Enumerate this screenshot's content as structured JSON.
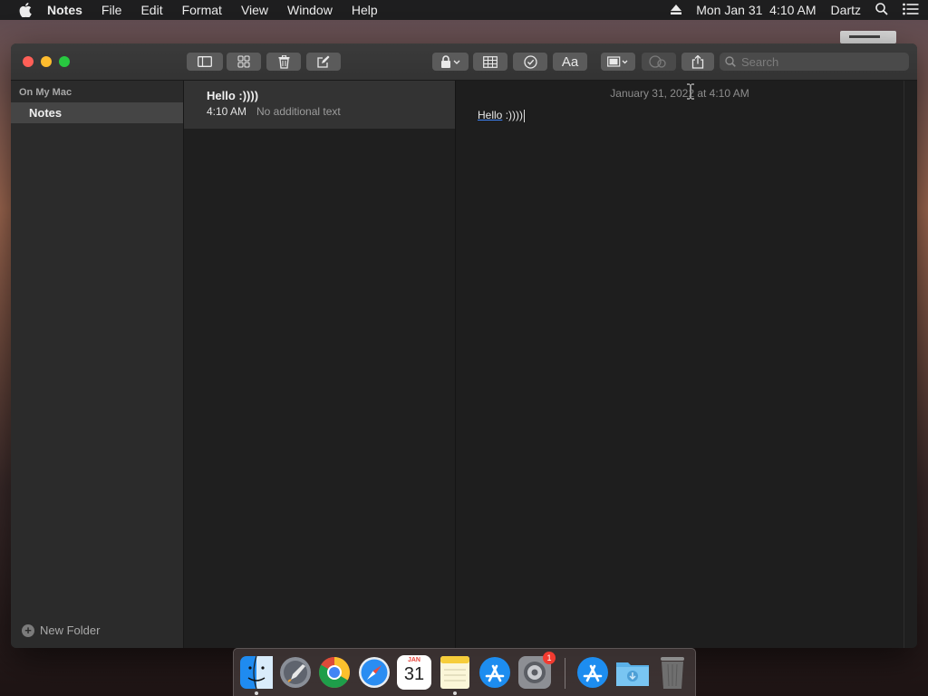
{
  "menubar": {
    "app_name": "Notes",
    "items": [
      "File",
      "Edit",
      "Format",
      "View",
      "Window",
      "Help"
    ],
    "clock": "Mon Jan 31  4:10 AM",
    "user": "Dartz"
  },
  "search": {
    "placeholder": "Search"
  },
  "sidebar": {
    "section": "On My Mac",
    "folder": "Notes",
    "new_folder": "New Folder"
  },
  "notes": [
    {
      "title": "Hello :))))",
      "time": "4:10 AM",
      "preview": "No additional text"
    }
  ],
  "editor": {
    "date": "January 31, 2022 at 4:10 AM",
    "word": "Hello",
    "rest": " :))))"
  },
  "dock": {
    "calendar_day": "31",
    "calendar_month": "JAN",
    "system_prefs_badge": "1"
  },
  "colors": {
    "close": "#ff5f57",
    "minimize": "#febc2e",
    "maximize": "#28c840",
    "selection": "#454545",
    "spell_underline": "#3d82f5"
  }
}
